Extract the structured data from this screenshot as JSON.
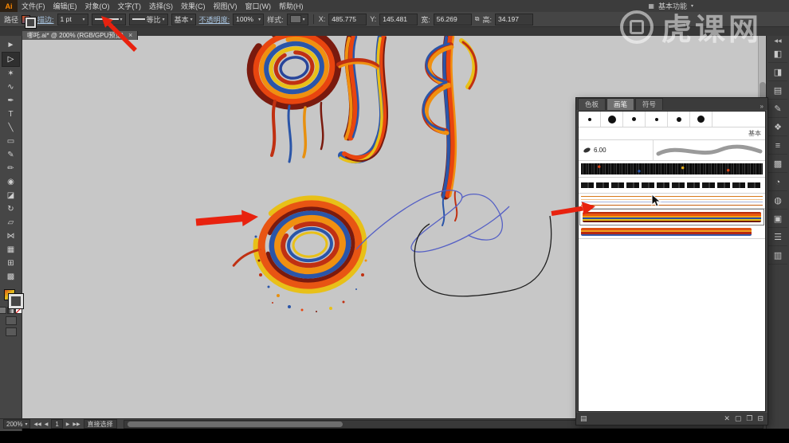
{
  "app": {
    "logo_text": "Ai",
    "watermark_text": "虎课网"
  },
  "menu": {
    "items": [
      {
        "label": "文件(F)"
      },
      {
        "label": "编辑(E)"
      },
      {
        "label": "对象(O)"
      },
      {
        "label": "文字(T)"
      },
      {
        "label": "选择(S)"
      },
      {
        "label": "效果(C)"
      },
      {
        "label": "视图(V)"
      },
      {
        "label": "窗口(W)"
      },
      {
        "label": "帮助(H)"
      }
    ],
    "layout_icon": "▦",
    "workspace_label": "基本功能",
    "workspace_caret": "▾"
  },
  "control_bar": {
    "selection_type": "路径",
    "stroke_label": "描边:",
    "stroke_width": "1 pt",
    "width_profile": "等比",
    "brush_definition": "基本",
    "opacity_label": "不透明度:",
    "opacity_value": "100%",
    "style_label": "样式:",
    "x_label": "X:",
    "x_value": "485.775",
    "y_label": "Y:",
    "y_value": "145.481",
    "w_label": "宽:",
    "w_value": "56.269",
    "h_label": "高:",
    "h_value": "34.197",
    "link_icon": "⧉",
    "caret": "▾"
  },
  "document_tab": {
    "title": "哪吒.ai* @ 200% (RGB/GPU预览)",
    "close_icon": "×"
  },
  "toolbar": {
    "tools": [
      {
        "name": "selection",
        "glyph": "►"
      },
      {
        "name": "direct-selection",
        "glyph": "▷"
      },
      {
        "name": "magic-wand",
        "glyph": "✶"
      },
      {
        "name": "lasso",
        "glyph": "∿"
      },
      {
        "name": "pen",
        "glyph": "✒"
      },
      {
        "name": "type",
        "glyph": "T"
      },
      {
        "name": "line-segment",
        "glyph": "╲"
      },
      {
        "name": "rectangle",
        "glyph": "▭"
      },
      {
        "name": "paintbrush",
        "glyph": "✎"
      },
      {
        "name": "pencil",
        "glyph": "✏"
      },
      {
        "name": "blob-brush",
        "glyph": "◉"
      },
      {
        "name": "eraser",
        "glyph": "◪"
      },
      {
        "name": "rotate",
        "glyph": "↻"
      },
      {
        "name": "scale",
        "glyph": "▱"
      },
      {
        "name": "width",
        "glyph": "⋈"
      },
      {
        "name": "free-transform",
        "glyph": "▦"
      },
      {
        "name": "mesh",
        "glyph": "⊞"
      },
      {
        "name": "gradient",
        "glyph": "▩"
      }
    ]
  },
  "dock": {
    "expand_icon": "◀◀",
    "icons": [
      {
        "name": "color",
        "glyph": "◧"
      },
      {
        "name": "color-guide",
        "glyph": "◨"
      },
      {
        "name": "swatches",
        "glyph": "▤"
      },
      {
        "name": "brushes",
        "glyph": "✎"
      },
      {
        "name": "symbols",
        "glyph": "❖"
      },
      {
        "name": "stroke",
        "glyph": "≡"
      },
      {
        "name": "gradient",
        "glyph": "▩"
      },
      {
        "name": "transparency",
        "glyph": "◔"
      },
      {
        "name": "appearance",
        "glyph": "◍"
      },
      {
        "name": "graphic-styles",
        "glyph": "▣"
      },
      {
        "name": "layers",
        "glyph": "☰"
      },
      {
        "name": "artboards",
        "glyph": "▥"
      }
    ]
  },
  "panel": {
    "tabs": [
      {
        "label": "色板"
      },
      {
        "label": "画笔"
      },
      {
        "label": "符号"
      }
    ],
    "collapse_icon": "»",
    "round_brushes": [
      {
        "style": "width:4px;height:4px"
      },
      {
        "style": "width:10px;height:10px"
      },
      {
        "style": "width:5px;height:5px"
      },
      {
        "style": "width:4px;height:4px"
      },
      {
        "style": "width:6px;height:6px"
      },
      {
        "style": "width:9px;height:9px"
      }
    ],
    "basic_label": "基本",
    "brush_size": "6.00",
    "bottom": {
      "library_icon": "▤",
      "remove_icon": "✕",
      "options_icon": "▢",
      "new_icon": "❐",
      "delete_icon": "⊟"
    }
  },
  "status_bar": {
    "zoom": "200%",
    "caret": "▾",
    "nav_first": "◀◀",
    "nav_prev": "◀",
    "artboard": "1",
    "nav_next": "▶",
    "nav_last": "▶▶",
    "tool_name": "直接选择"
  },
  "colors": {
    "arrow_red": "#e8220f",
    "canvas": "#c7c7c7",
    "path_blue": "#5560c5",
    "path_black": "#1f1f1f"
  }
}
